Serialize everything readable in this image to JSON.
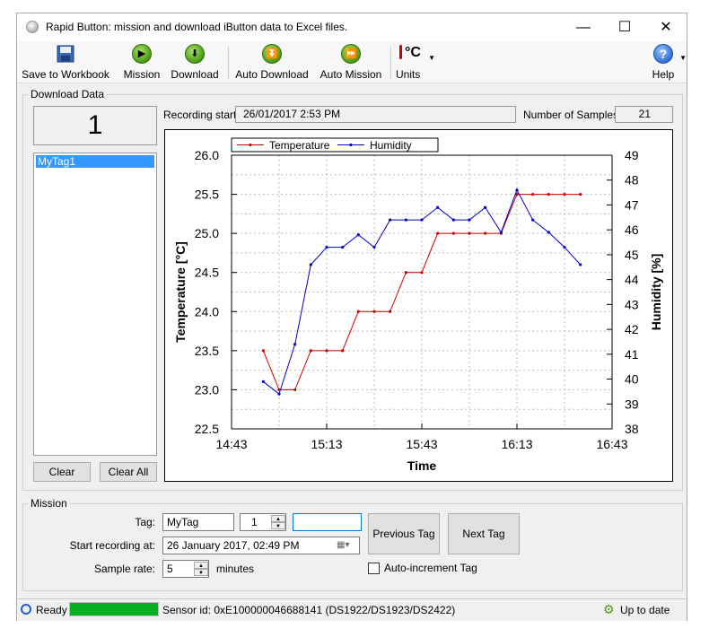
{
  "window": {
    "title": "Rapid Button: mission and download iButton data to Excel files."
  },
  "toolbar": {
    "save_label": "Save to Workbook",
    "mission_label": "Mission",
    "download_label": "Download",
    "auto_download_label": "Auto Download",
    "auto_mission_label": "Auto Mission",
    "units_label": "Units",
    "units_icon_text": "°C",
    "help_label": "Help"
  },
  "download": {
    "group_label": "Download Data",
    "counter": "1",
    "tags": [
      "MyTag1"
    ],
    "clear_label": "Clear",
    "clear_all_label": "Clear All",
    "recording_start_label": "Recording start:",
    "recording_start_value": "26/01/2017 2:53 PM",
    "samples_label": "Number of Samples:",
    "samples_value": "21"
  },
  "chart_data": {
    "type": "line",
    "xlabel": "Time",
    "ylabel": "Temperature [°C]",
    "y2label": "Humidity [%]",
    "x_ticks": [
      "14:43",
      "15:13",
      "15:43",
      "16:13",
      "16:43"
    ],
    "x_range_minutes": [
      0,
      120
    ],
    "ylim": [
      22.5,
      26.0
    ],
    "y_ticks": [
      "26.0",
      "25.5",
      "25.0",
      "24.5",
      "24.0",
      "23.5",
      "23.0",
      "22.5"
    ],
    "y2lim": [
      38,
      49
    ],
    "y2_ticks": [
      "49",
      "48",
      "47",
      "46",
      "45",
      "44",
      "43",
      "42",
      "41",
      "40",
      "39",
      "38"
    ],
    "legend_position": "top",
    "grid": true,
    "x_minutes": [
      10,
      15,
      20,
      25,
      30,
      35,
      40,
      45,
      50,
      55,
      60,
      65,
      70,
      75,
      80,
      85,
      90,
      95,
      100,
      105,
      110
    ],
    "series": [
      {
        "name": "Temperature",
        "axis": "left",
        "color": "#cc0000",
        "values": [
          23.5,
          23.0,
          23.0,
          23.5,
          23.5,
          23.5,
          24.0,
          24.0,
          24.0,
          24.5,
          24.5,
          25.0,
          25.0,
          25.0,
          25.0,
          25.0,
          25.5,
          25.5,
          25.5,
          25.5,
          25.5
        ]
      },
      {
        "name": "Humidity",
        "axis": "right",
        "color": "#0000cc",
        "values": [
          39.9,
          39.4,
          41.4,
          44.6,
          45.3,
          45.3,
          45.8,
          45.3,
          46.4,
          46.4,
          46.4,
          46.9,
          46.4,
          46.4,
          46.9,
          45.9,
          47.6,
          46.4,
          45.9,
          45.3,
          44.6
        ]
      }
    ]
  },
  "mission": {
    "group_label": "Mission",
    "tag_label": "Tag:",
    "tag_value": "MyTag",
    "tag_number": "1",
    "tag_extra": "",
    "start_label": "Start recording at:",
    "start_value": "26   January   2017, 02:49 PM",
    "rate_label": "Sample rate:",
    "rate_value": "5",
    "rate_unit": "minutes",
    "prev_tag_label": "Previous Tag",
    "next_tag_label": "Next Tag",
    "auto_increment_label": "Auto-increment Tag",
    "auto_increment_checked": false
  },
  "status": {
    "ready_label": "Ready",
    "progress": 1.0,
    "sensor_text": "Sensor id: 0xE100000046688141 (DS1922/DS1923/DS2422)",
    "update_label": "Up to date"
  }
}
